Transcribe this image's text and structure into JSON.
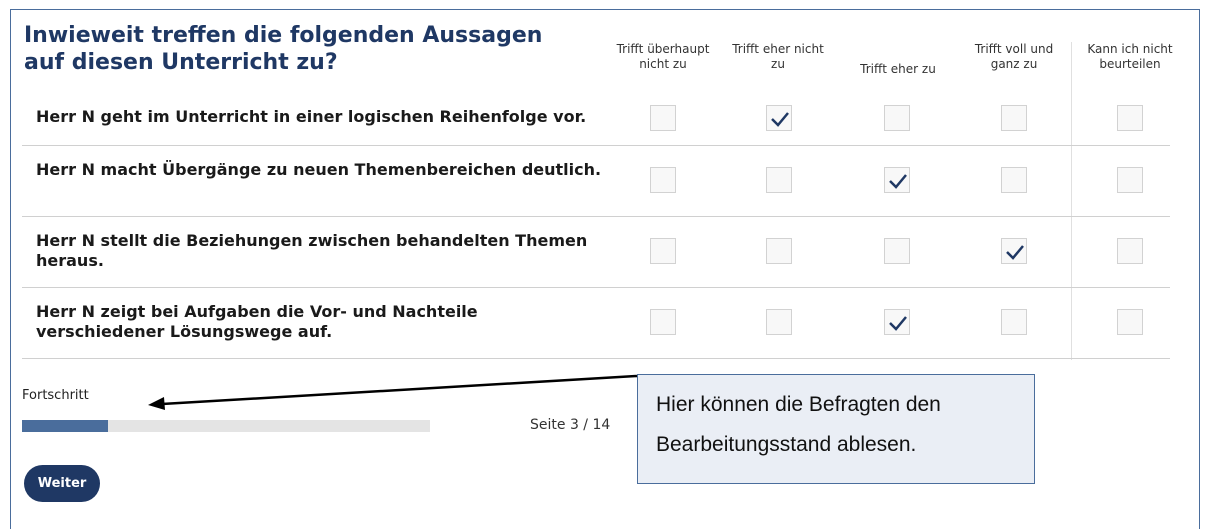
{
  "question": {
    "title": "Inwieweit treffen die folgenden Aussagen auf diesen Unterricht zu?"
  },
  "columns": [
    "Trifft überhaupt nicht zu",
    "Trifft eher nicht zu",
    "Trifft eher zu",
    "Trifft voll und ganz zu",
    "Kann ich nicht beurteilen"
  ],
  "rows": [
    {
      "label": "Herr N geht im Unterricht in einer logischen Reihenfolge vor.",
      "checked": 1
    },
    {
      "label": "Herr N macht Übergänge zu neuen Themenbereichen deutlich.",
      "checked": 2
    },
    {
      "label": "Herr N stellt die Beziehungen zwischen behandelten Themen heraus.",
      "checked": 3
    },
    {
      "label": "Herr N zeigt bei Aufgaben die Vor- und Nachteile verschiedener Lösungswege auf.",
      "checked": 2
    }
  ],
  "progress": {
    "label": "Fortschritt",
    "page_text": "Seite 3 / 14",
    "current": 3,
    "total": 14,
    "fraction": 0.21
  },
  "buttons": {
    "next_label": "Weiter"
  },
  "annotation": {
    "text": "Hier können die Befragten den Bearbeitungsstand ablesen."
  },
  "colors": {
    "accent": "#1f3864",
    "progress_fill": "#4a6d9c",
    "check": "#1f3864"
  },
  "icons": {
    "check": "check-icon"
  }
}
